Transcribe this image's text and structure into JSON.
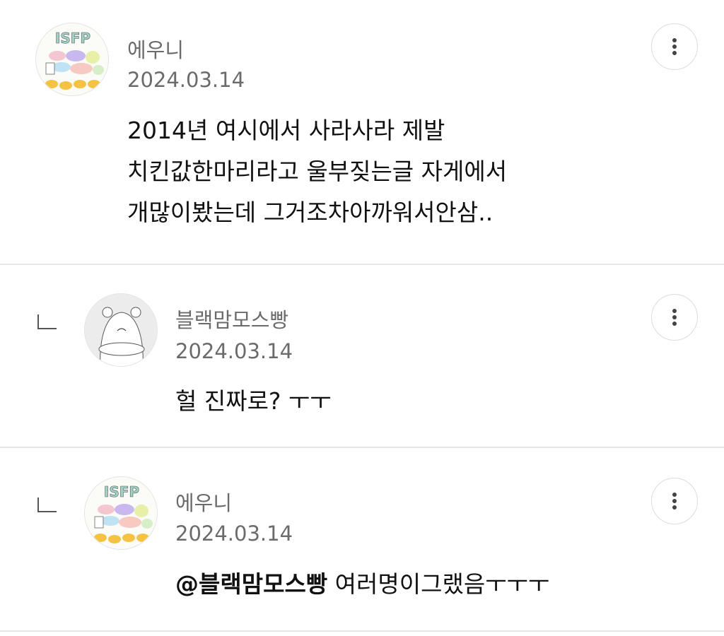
{
  "comments": [
    {
      "author": "에우니",
      "date": "2024.03.14",
      "lines": [
        "2014년 여시에서 사라사라 제발",
        "치킨값한마리라고 울부짖는글 자게에서",
        "개많이봤는데 그거조차아까워서안삼.."
      ],
      "avatar_text": "ISFP",
      "avatar_icon": "isfp-sticker-avatar"
    },
    {
      "author": "블랙맘모스빵",
      "date": "2024.03.14",
      "text": "헐 진짜로? ㅜㅜ",
      "is_reply": true,
      "avatar_icon": "hamster-avatar"
    },
    {
      "author": "에우니",
      "date": "2024.03.14",
      "mention": "@블랙맘모스빵",
      "text": "여러명이그랬음ㅜㅜㅜ",
      "is_reply": true,
      "avatar_text": "ISFP",
      "avatar_icon": "isfp-sticker-avatar"
    }
  ],
  "icons": {
    "more": "more-vertical-icon",
    "reply": "reply-arrow-icon"
  },
  "colors": {
    "meta_text": "#6b6b6b",
    "divider": "#e6e6e6",
    "body_text": "#111111"
  }
}
